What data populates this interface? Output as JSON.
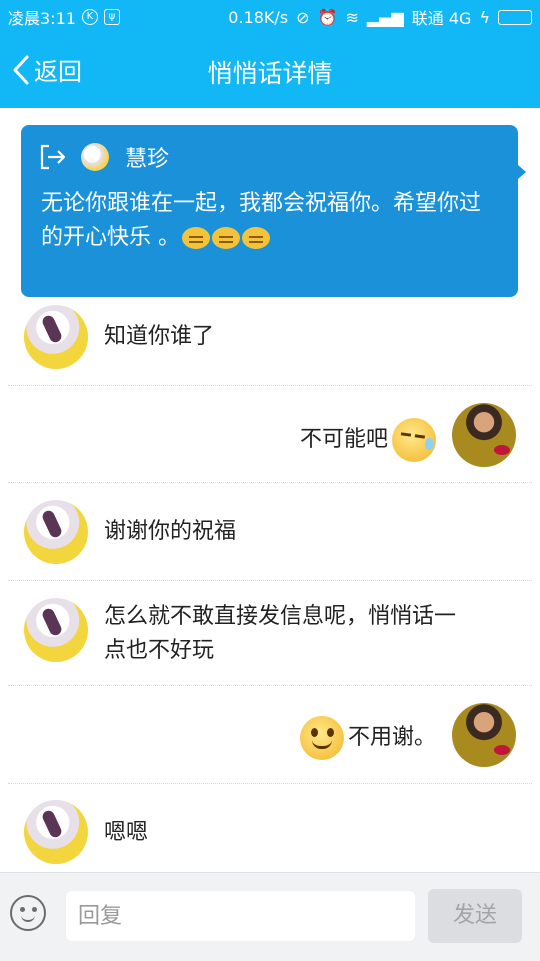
{
  "statusbar": {
    "time": "凌晨3:11",
    "network_speed": "0.18K/s",
    "carrier": "联通 4G"
  },
  "navbar": {
    "back_label": "返回",
    "title": "悄悄话详情"
  },
  "card": {
    "name": "慧珍",
    "message": "无论你跟谁在一起，我都会祝福你。希望你过的开心快乐 。"
  },
  "messages": [
    {
      "side": "left",
      "text": "知道你谁了"
    },
    {
      "side": "right",
      "text": "不可能吧",
      "emoji": "sweat-emoji"
    },
    {
      "side": "left",
      "text": "谢谢你的祝福"
    },
    {
      "side": "left",
      "text": "怎么就不敢直接发信息呢，悄悄话一点也不好玩"
    },
    {
      "side": "right",
      "text": "不用谢。",
      "emoji": "smile-emoji"
    },
    {
      "side": "left",
      "text": "嗯嗯"
    }
  ],
  "input": {
    "placeholder": "回复",
    "send_label": "发送"
  },
  "colors": {
    "accent": "#12b7f5",
    "card": "#1a91d8"
  }
}
